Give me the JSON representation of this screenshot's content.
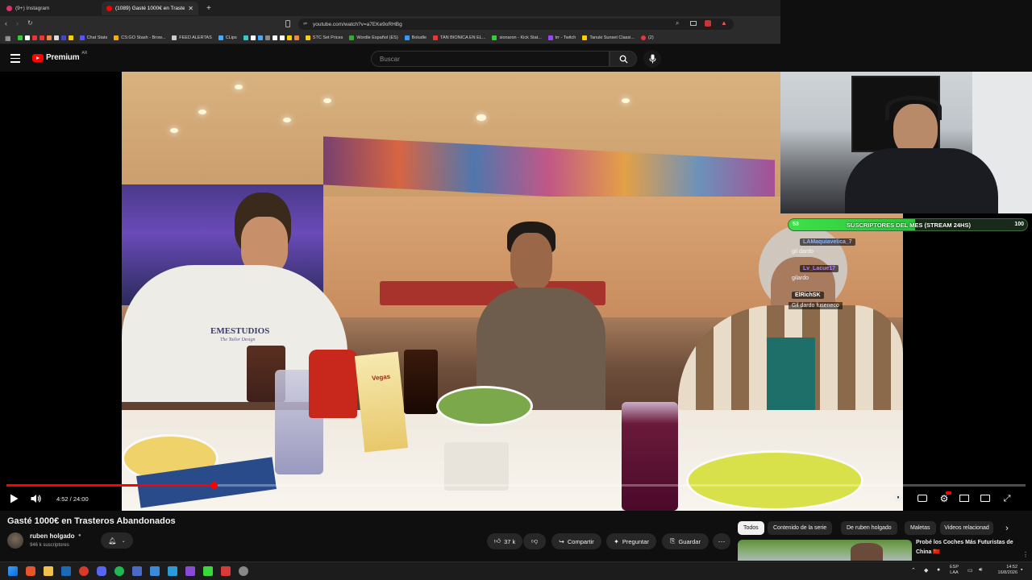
{
  "browser": {
    "tabs": [
      {
        "label": "(9+) Instagram",
        "active": false
      },
      {
        "label": "(1089) Gasté 1000€ en Trasteros",
        "active": true
      }
    ],
    "url": "youtube.com/watch?v=a7EKe9oRHBg",
    "bookmarks": [
      "Chat Stats",
      "CS:GO Stash - Brow...",
      "FEED ALERTAS",
      "CLips",
      "STC Set Prices",
      "Wordle Español (ES)",
      "Boludle",
      "TAN BIONICA EN EL...",
      "sionaron - Kick Stat...",
      "trr - Twitch",
      "Tanuki Sunset Classi...",
      "(2)"
    ]
  },
  "youtube": {
    "logo_text": "Premium",
    "logo_region": "AR",
    "search_placeholder": "Buscar"
  },
  "stream_overlay": {
    "sub_goal": {
      "current": "53",
      "label": "SUSCRIPTORES DEL MES (STREAM 24HS)",
      "target": "100",
      "progress_fraction": 0.53
    },
    "chat": [
      {
        "user": "LAMaquiavelica_7",
        "text": "gil dardo",
        "color": "#8fb0ff"
      },
      {
        "user": "Lv_Lacue17",
        "text": "gilardo",
        "color": "#b77cff"
      },
      {
        "user": "ElRichSK",
        "text": "Gil dardo fuseneco",
        "color": "#ffffff"
      }
    ]
  },
  "player": {
    "time_current": "4:52",
    "time_total": "24:00",
    "time_display": "4:52 / 24:00",
    "progress_fraction": 0.203,
    "scene_text": {
      "shirt": "EMESTUDIOS",
      "shirt_small": "The Tailor Design",
      "sign": "Vegas"
    }
  },
  "video": {
    "title": "Gasté 1000€ en Trasteros Abandonados",
    "channel_name": "ruben holgado",
    "subscribers": "946 k suscriptores",
    "likes": "37 k",
    "share_label": "Compartir",
    "ask_label": "Preguntar",
    "save_label": "Guardar"
  },
  "chips": [
    {
      "label": "Todos",
      "active": true
    },
    {
      "label": "Contenido de la serie",
      "active": false
    },
    {
      "label": "De ruben holgado",
      "active": false
    },
    {
      "label": "Maletas",
      "active": false
    },
    {
      "label": "Videos relacionad",
      "active": false
    }
  ],
  "recommendation": {
    "title_line1": "Probé los Coches Más Futuristas de",
    "title_line2": "China 🇨🇳"
  },
  "taskbar": {
    "lang_top": "ESP",
    "lang_bottom": "LAA",
    "time": "14:52",
    "date": "16/8/2026"
  },
  "colors": {
    "accent_red": "#ff0000",
    "sub_bar_green": "#3de04a"
  }
}
